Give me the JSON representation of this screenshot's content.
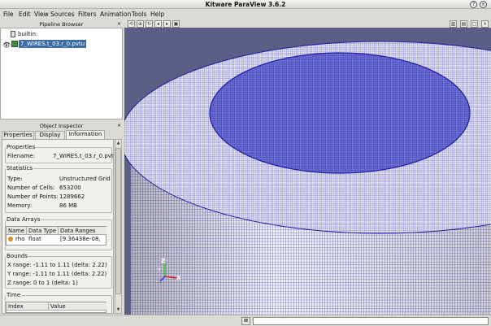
{
  "window": {
    "title": "Kitware ParaView 3.6.2",
    "buttons": [
      "?",
      "×"
    ]
  },
  "menu": [
    "File",
    "Edit",
    "View",
    "Sources",
    "Filters",
    "Animation",
    "Tools",
    "Help"
  ],
  "pipeline_browser": {
    "title": "Pipeline Browser",
    "close": "×",
    "root": "builtin:",
    "source": "7_WIRES.t_03.r_0.pvtu"
  },
  "object_inspector": {
    "title": "Object Inspector",
    "close": "×",
    "tabs": [
      "Properties",
      "Display",
      "Information"
    ],
    "active_tab": "Information"
  },
  "properties": {
    "group": "Properties",
    "filename_label": "Filename:",
    "filename": "7_WIRES.t_03.r_0.pvtu"
  },
  "statistics": {
    "group": "Statistics",
    "rows": [
      {
        "label": "Type:",
        "value": "Unstructured Grid"
      },
      {
        "label": "Number of Cells:",
        "value": "653200"
      },
      {
        "label": "Number of Points:",
        "value": "1289662"
      },
      {
        "label": "Memory:",
        "value": "86 MB"
      }
    ]
  },
  "data_arrays": {
    "group": "Data Arrays",
    "headers": [
      "Name",
      "Data Type",
      "Data Ranges"
    ],
    "rows": [
      {
        "name": "rho",
        "type": "float",
        "range": "[9.36438e-08,"
      }
    ]
  },
  "bounds": {
    "group": "Bounds",
    "rows": [
      "X range: -1.11 to 1.11 (delta: 2.22)",
      "Y range: -1.11 to 1.11 (delta: 2.22)",
      "Z range: 0 to 1 (delta: 1)"
    ]
  },
  "time": {
    "group": "Time",
    "headers": [
      "Index",
      "Value"
    ]
  },
  "axes": {
    "z": "Z",
    "y": "Y",
    "x": "X"
  },
  "colors": {
    "background": "#5b5e87",
    "mesh": "#1c1aa0",
    "selection": "#3a6ea5"
  }
}
